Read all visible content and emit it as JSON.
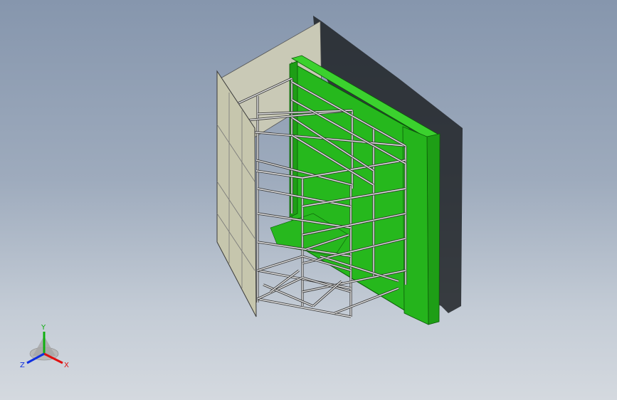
{
  "viewport": {
    "background_top": "#8696ad",
    "background_bottom": "#d4d9df"
  },
  "model": {
    "frame_color": "#e8e8e8",
    "frame_edge": "#3a3a3a",
    "green_wall_color": "#22b51a",
    "green_dark": "#149010",
    "panel_color": "#c8c8b2",
    "shadow_color": "#202428"
  },
  "triad": {
    "x_label": "X",
    "y_label": "Y",
    "z_label": "Z",
    "x_color": "#e01010",
    "y_color": "#10b010",
    "z_color": "#1030e0"
  }
}
